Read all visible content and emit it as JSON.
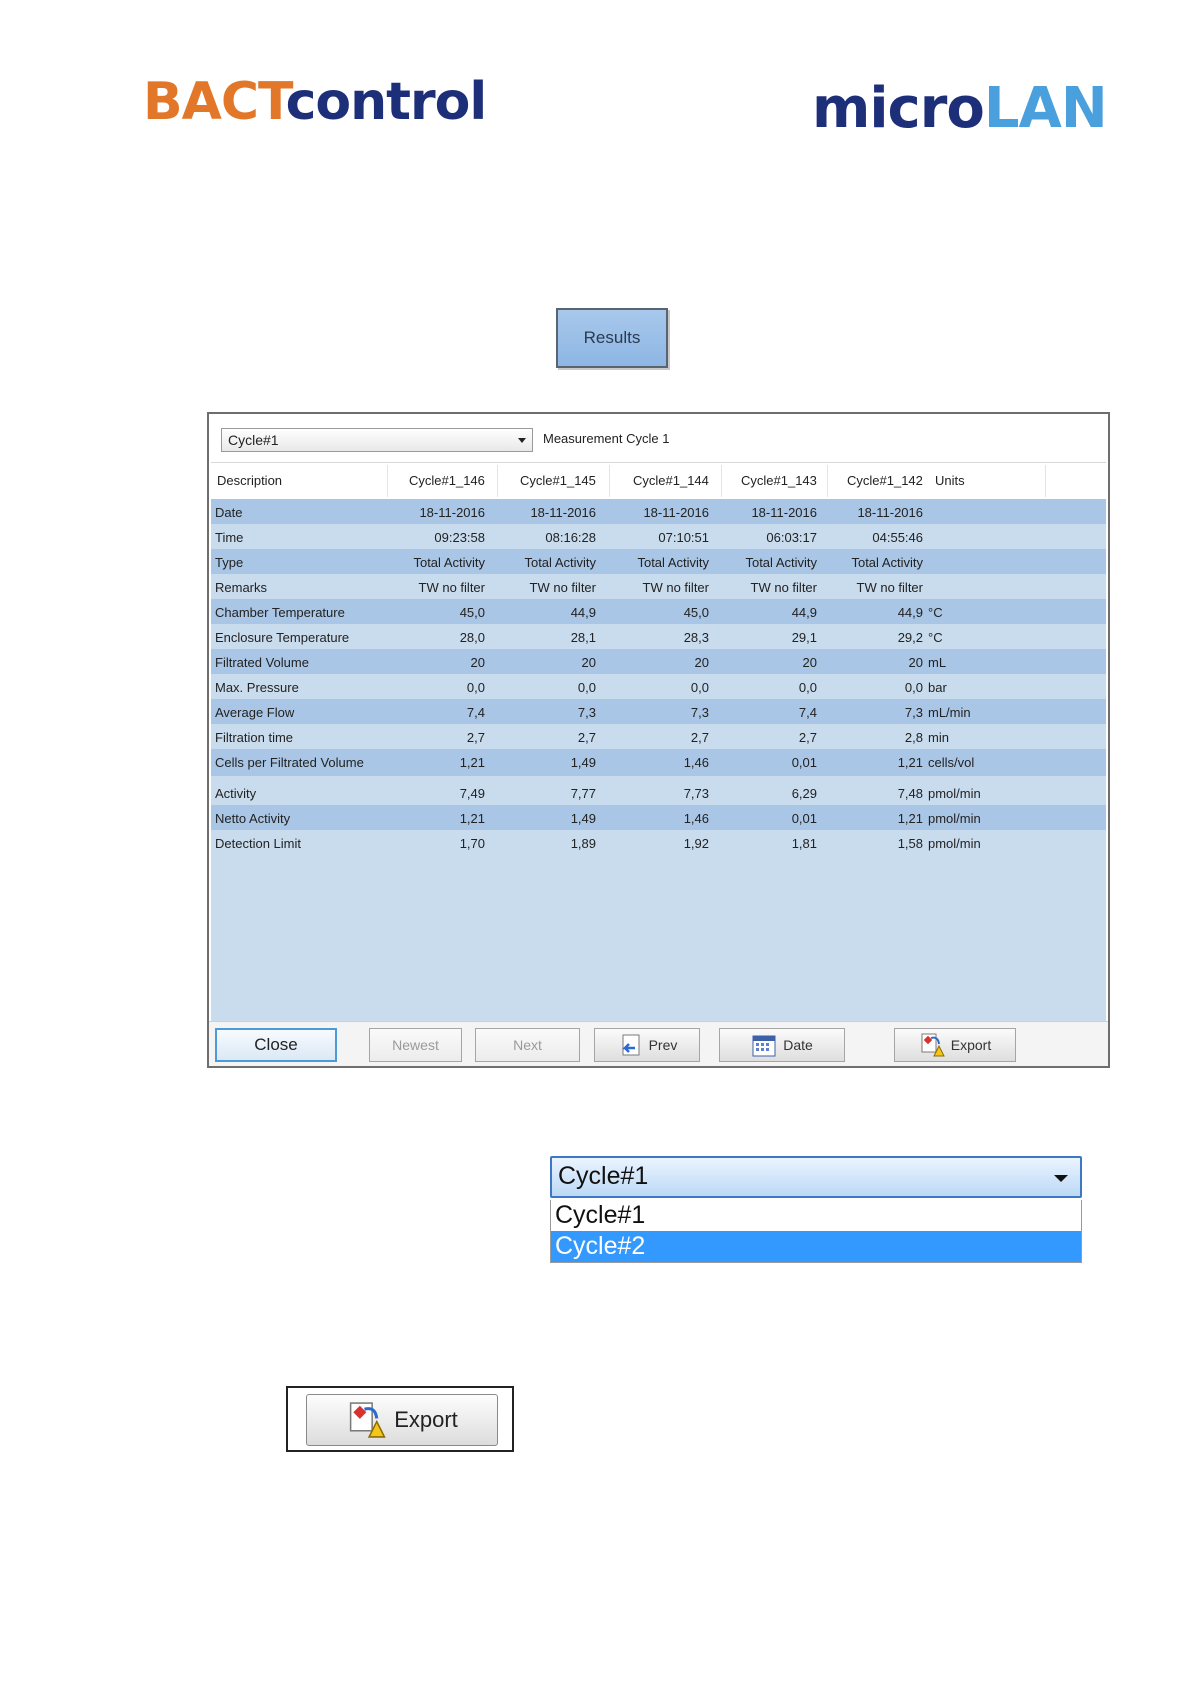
{
  "logos": {
    "left_part1": "BACT",
    "left_part2": "control",
    "right_part1": "micro",
    "right_part2": "LAN"
  },
  "results_button": {
    "label": "Results"
  },
  "window": {
    "cycle_select": {
      "value": "Cycle#1"
    },
    "cycle_description": "Measurement Cycle 1",
    "columns": [
      "Description",
      "Cycle#1_146",
      "Cycle#1_145",
      "Cycle#1_144",
      "Cycle#1_143",
      "Cycle#1_142",
      "Units"
    ],
    "rows": [
      {
        "label": "Date",
        "values": [
          "18-11-2016",
          "18-11-2016",
          "18-11-2016",
          "18-11-2016",
          "18-11-2016"
        ],
        "unit": ""
      },
      {
        "label": "Time",
        "values": [
          "09:23:58",
          "08:16:28",
          "07:10:51",
          "06:03:17",
          "04:55:46"
        ],
        "unit": ""
      },
      {
        "label": "Type",
        "values": [
          "Total Activity",
          "Total Activity",
          "Total Activity",
          "Total Activity",
          "Total Activity"
        ],
        "unit": ""
      },
      {
        "label": "Remarks",
        "values": [
          "TW no filter",
          "TW no filter",
          "TW no filter",
          "TW no filter",
          "TW no filter"
        ],
        "unit": ""
      },
      {
        "label": "Chamber Temperature",
        "values": [
          "45,0",
          "44,9",
          "45,0",
          "44,9",
          "44,9"
        ],
        "unit": "°C"
      },
      {
        "label": "Enclosure Temperature",
        "values": [
          "28,0",
          "28,1",
          "28,3",
          "29,1",
          "29,2"
        ],
        "unit": "°C"
      },
      {
        "label": "Filtrated Volume",
        "values": [
          "20",
          "20",
          "20",
          "20",
          "20"
        ],
        "unit": "mL"
      },
      {
        "label": "Max. Pressure",
        "values": [
          "0,0",
          "0,0",
          "0,0",
          "0,0",
          "0,0"
        ],
        "unit": "bar"
      },
      {
        "label": "Average Flow",
        "values": [
          "7,4",
          "7,3",
          "7,3",
          "7,4",
          "7,3"
        ],
        "unit": "mL/min"
      },
      {
        "label": "Filtration time",
        "values": [
          "2,7",
          "2,7",
          "2,7",
          "2,7",
          "2,8"
        ],
        "unit": "min"
      },
      {
        "label": "Cells per Filtrated Volume",
        "values": [
          "1,21",
          "1,49",
          "1,46",
          "0,01",
          "1,21"
        ],
        "unit": "cells/vol"
      },
      {
        "label": "Activity",
        "values": [
          "7,49",
          "7,77",
          "7,73",
          "6,29",
          "7,48"
        ],
        "unit": "pmol/min"
      },
      {
        "label": "Netto Activity",
        "values": [
          "1,21",
          "1,49",
          "1,46",
          "0,01",
          "1,21"
        ],
        "unit": "pmol/min"
      },
      {
        "label": "Detection Limit",
        "values": [
          "1,70",
          "1,89",
          "1,92",
          "1,81",
          "1,58"
        ],
        "unit": "pmol/min"
      }
    ],
    "buttons": {
      "close": "Close",
      "newest": "Newest",
      "next": "Next",
      "prev": "Prev",
      "date": "Date",
      "export": "Export"
    }
  },
  "dropdown_example": {
    "value": "Cycle#1",
    "options": [
      "Cycle#1",
      "Cycle#2"
    ],
    "highlighted": "Cycle#2"
  },
  "export_button_example": {
    "label": "Export"
  },
  "colors": {
    "bact_orange": "#e2772a",
    "brand_navy": "#1e2f7a",
    "lan_blue": "#4aa0dd",
    "row_dark": "#a9c6e6",
    "row_light": "#c9dcee",
    "selection": "#3399ff"
  }
}
